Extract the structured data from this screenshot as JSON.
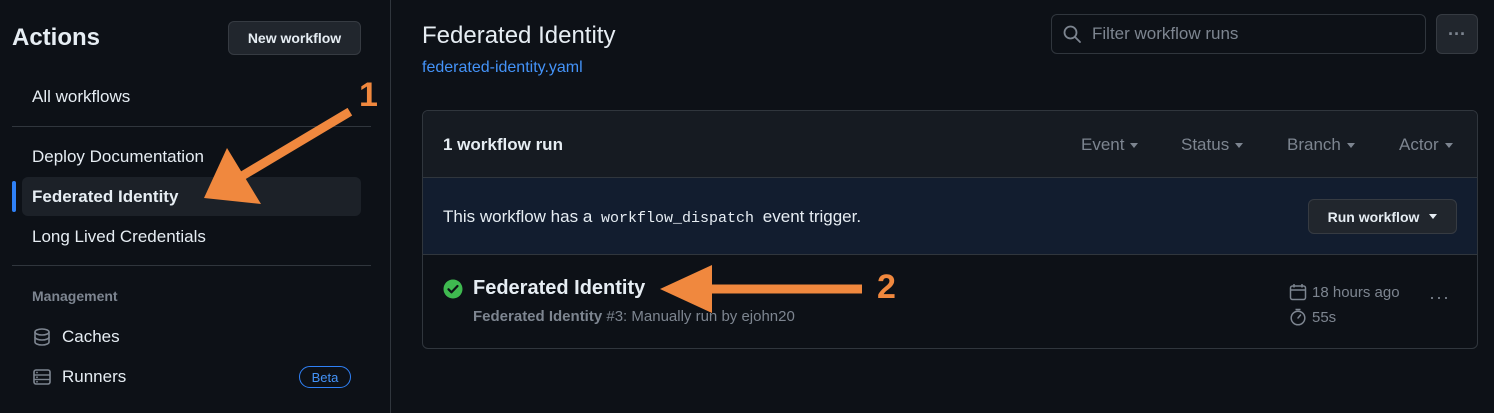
{
  "sidebar": {
    "title": "Actions",
    "new_workflow_label": "New workflow",
    "all_workflows": "All workflows",
    "workflows": [
      {
        "label": "Deploy Documentation"
      },
      {
        "label": "Federated Identity",
        "active": true
      },
      {
        "label": "Long Lived Credentials"
      }
    ],
    "management_label": "Management",
    "caches_label": "Caches",
    "runners_label": "Runners",
    "runners_badge": "Beta"
  },
  "header": {
    "title": "Federated Identity",
    "file_link": "federated-identity.yaml",
    "filter_placeholder": "Filter workflow runs",
    "more_icon": "kebab-horizontal-icon"
  },
  "runs_panel": {
    "count_label": "1 workflow run",
    "filters": [
      "Event",
      "Status",
      "Branch",
      "Actor"
    ],
    "dispatch": {
      "prefix": "This workflow has a",
      "code": "workflow_dispatch",
      "suffix": "event trigger.",
      "button_label": "Run workflow"
    },
    "runs": [
      {
        "status": "success",
        "title": "Federated Identity",
        "workflow_name": "Federated Identity",
        "run_info": "#3: Manually run by ejohn20",
        "time_ago": "18 hours ago",
        "duration": "55s"
      }
    ]
  },
  "annotations": {
    "num1": "1",
    "num2": "2",
    "color": "#f0883e"
  },
  "colors": {
    "background": "#0d1117",
    "accent": "#2f81f7",
    "link": "#4493f8",
    "success": "#3fb950",
    "muted": "#7d8590"
  }
}
